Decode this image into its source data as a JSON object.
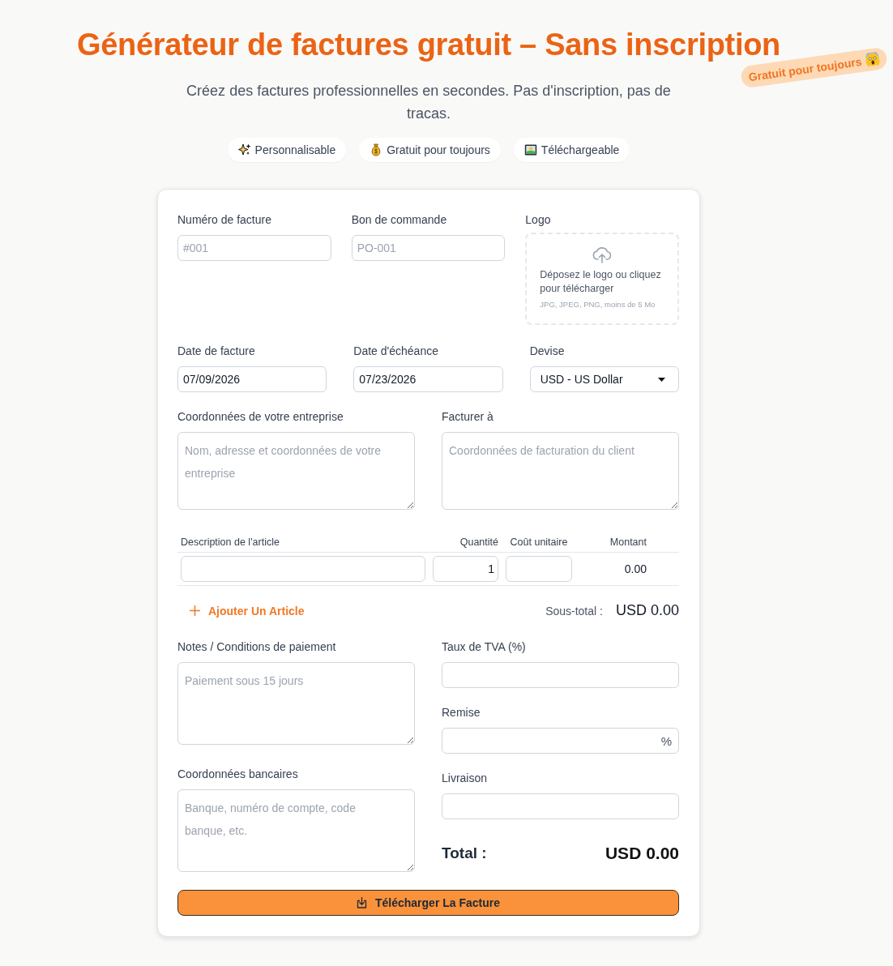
{
  "header": {
    "title": "Générateur de factures gratuit – Sans inscription",
    "badge": {
      "text": "Gratuit pour toujours"
    },
    "subtitle": "Créez des factures professionnelles en secondes. Pas d'inscription, pas de tracas.",
    "features": [
      {
        "kind": "sparkles",
        "label": "Personnalisable"
      },
      {
        "kind": "money",
        "label": "Gratuit pour toujours"
      },
      {
        "kind": "picture",
        "label": "Téléchargeable"
      }
    ]
  },
  "invoice_fields": [
    {
      "label": "Numéro de facture",
      "placeholder": "#001"
    },
    {
      "label": "Bon de commande",
      "placeholder": "PO-001"
    }
  ],
  "logo_upload": {
    "label": "Logo",
    "prompt": "Déposez le logo ou cliquez pour télécharger",
    "hint": "JPG, JPEG, PNG, moins de 5 Mo"
  },
  "date_fields": [
    {
      "kind": "date",
      "label": "Date de facture",
      "value": "07/09/2026"
    },
    {
      "kind": "date",
      "label": "Date d'échéance",
      "value": "07/23/2026"
    },
    {
      "kind": "select",
      "label": "Devise",
      "value": "USD - US Dollar"
    }
  ],
  "parties": [
    {
      "label": "Coordonnées de votre entreprise",
      "placeholder": "Nom, adresse et coordonnées de votre entreprise"
    },
    {
      "label": "Facturer à",
      "placeholder": "Coordonnées de facturation du client"
    }
  ],
  "items": {
    "columns": [
      "Description de l'article",
      "Quantité",
      "Coût unitaire",
      "Montant"
    ],
    "rows": [
      {
        "quantity": "1",
        "amount": "0.00"
      }
    ]
  },
  "add_item": "Ajouter Un Article",
  "subtotal": {
    "label": "Sous-total :",
    "value": "USD 0.00"
  },
  "notes": [
    {
      "label": "Notes / Conditions de paiement",
      "placeholder": "Paiement sous 15 jours"
    },
    {
      "label": "Coordonnées bancaires",
      "placeholder": "Banque, numéro de compte, code banque, etc."
    }
  ],
  "charges": [
    {
      "label": "Taux de TVA (%)"
    },
    {
      "label": "Remise",
      "suffix": "%"
    },
    {
      "label": "Livraison"
    }
  ],
  "total": {
    "label": "Total :",
    "value": "USD 0.00"
  },
  "download_button": "Télécharger La Facture"
}
